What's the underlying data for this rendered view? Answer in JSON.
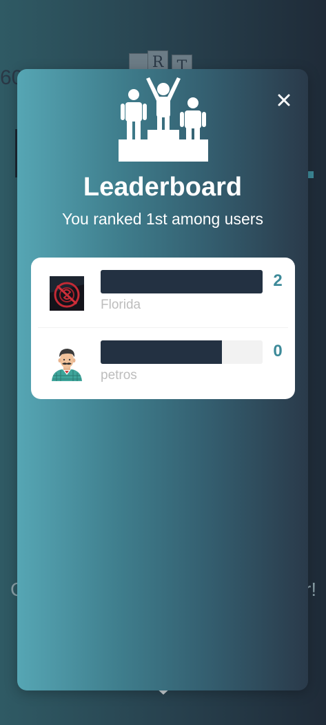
{
  "background": {
    "timer": "60",
    "tiles": [
      "",
      "R",
      "T"
    ],
    "left_text": "C",
    "right_text": "r!"
  },
  "modal": {
    "title": "Leaderboard",
    "subtitle": "You ranked 1st among users",
    "close_icon": "close-icon",
    "header_icon": "podium-icon"
  },
  "leaderboard": {
    "max_score": 2,
    "entries": [
      {
        "name": "Florida",
        "score": "2",
        "bar_fraction": 1.0,
        "avatar": "red-logo-avatar"
      },
      {
        "name": "petros",
        "score": "0",
        "bar_fraction": 0.75,
        "avatar": "mustache-man-avatar"
      }
    ]
  },
  "colors": {
    "accent": "#3d8a99",
    "bar": "#233142",
    "track": "#f2f2f2",
    "name": "#bdbdbd"
  }
}
